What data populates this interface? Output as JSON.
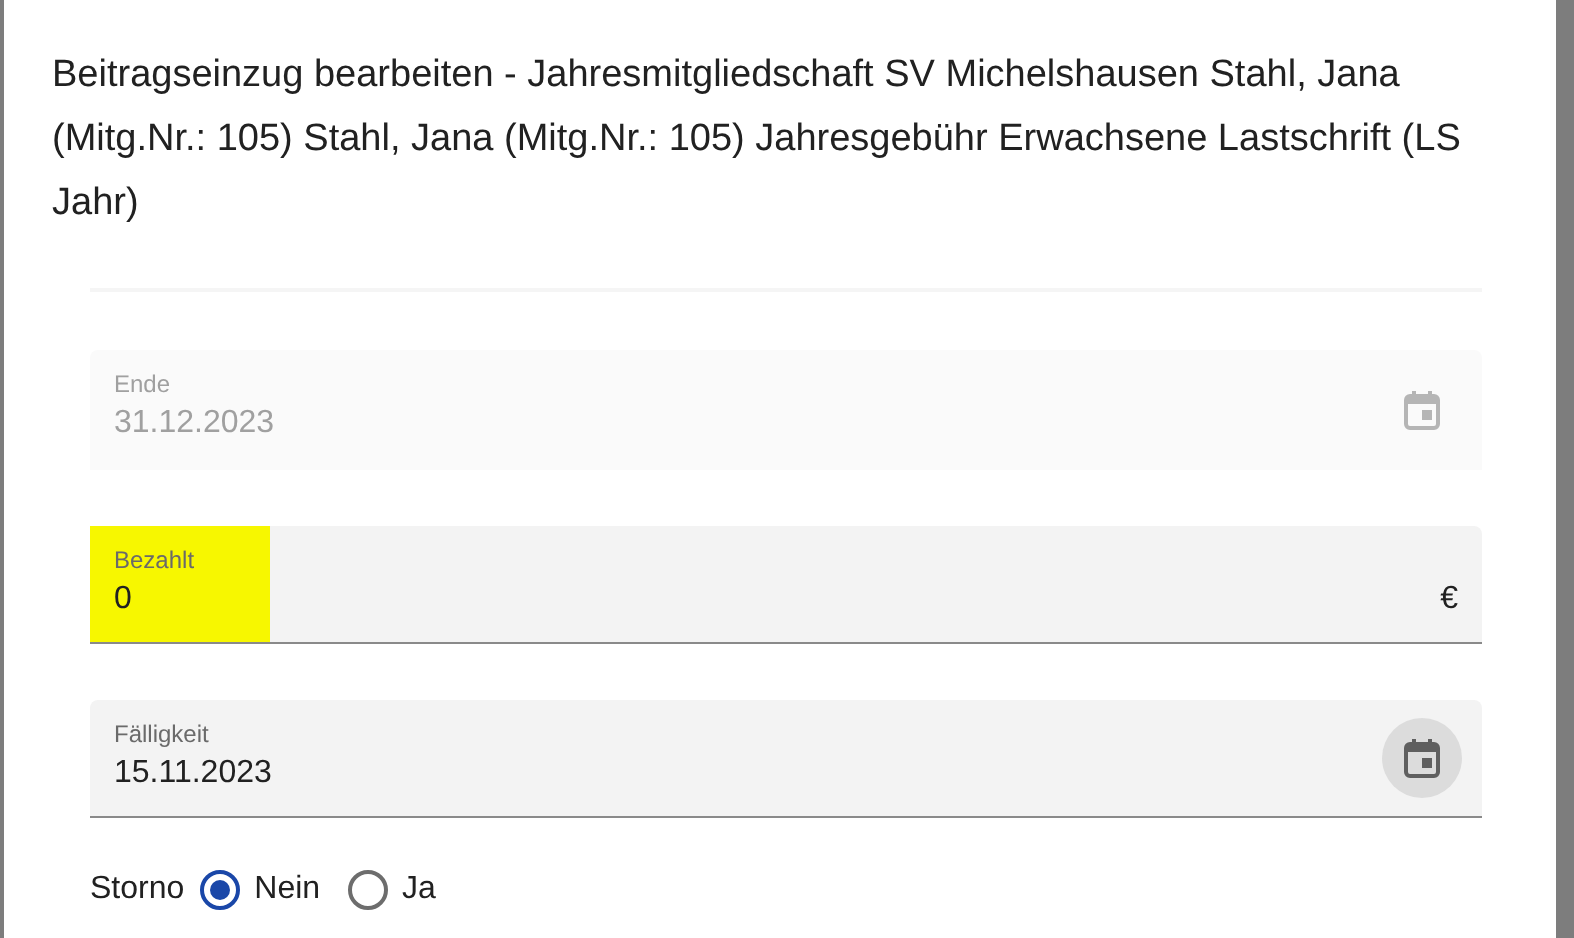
{
  "dialog": {
    "title": "Beitragseinzug bearbeiten - Jahresmitgliedschaft SV Michelshausen Stahl, Jana (Mitg.Nr.: 105) Stahl, Jana (Mitg.Nr.: 105) Jahresgebühr Erwachsene Lastschrift (LS Jahr)"
  },
  "fields": [
    {
      "kind": "date",
      "label": "Ende",
      "value": "31.12.2023",
      "disabled": true,
      "highlighted": false
    },
    {
      "kind": "currency",
      "label": "Bezahlt",
      "value": "0",
      "suffix": "€",
      "disabled": false,
      "highlighted": true
    },
    {
      "kind": "date",
      "label": "Fälligkeit",
      "value": "15.11.2023",
      "disabled": false,
      "highlighted": false
    }
  ],
  "storno": {
    "label": "Storno",
    "options": [
      {
        "label": "Nein",
        "selected": true
      },
      {
        "label": "Ja",
        "selected": false
      }
    ]
  }
}
